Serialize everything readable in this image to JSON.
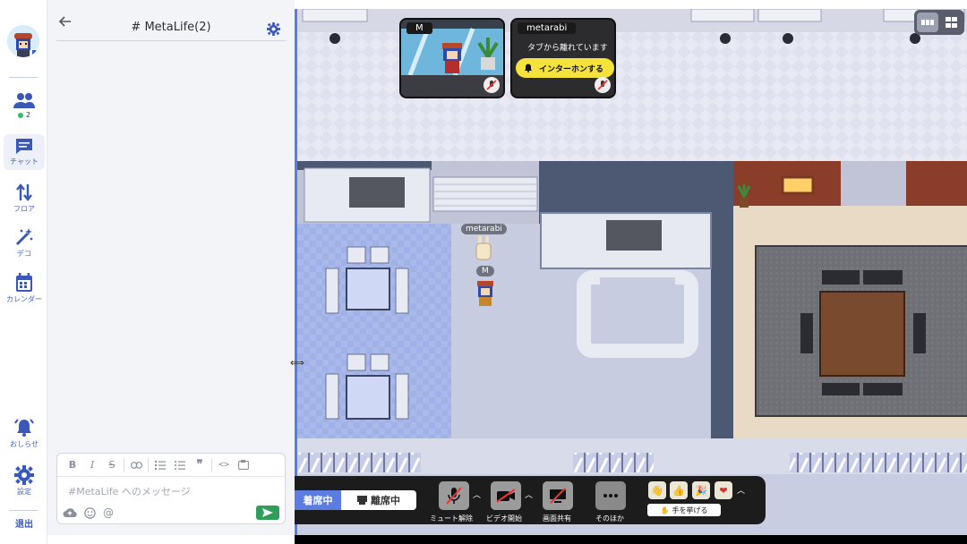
{
  "rail": {
    "members_label": "2",
    "chat_label": "チャット",
    "floor_label": "フロア",
    "deco_label": "デコ",
    "calendar_label": "カレンダー",
    "notice_label": "おしらせ",
    "settings_label": "設定",
    "exit_label": "退出"
  },
  "chat": {
    "title": "# MetaLife(2)",
    "placeholder": "#MetaLife へのメッセージ"
  },
  "video": {
    "self_name": "M",
    "other_name": "metarabi",
    "other_status": "タブから離れています",
    "intercom_label": "インターホンする"
  },
  "world": {
    "rabbit_name": "metarabi",
    "avatar_name": "M"
  },
  "toolbar": {
    "present_label": "着席中",
    "away_label": "離席中",
    "mute_label": "ミュート解除",
    "video_label": "ビデオ開始",
    "share_label": "画面共有",
    "more_label": "そのほか",
    "raise_hand_label": "手を挙げる"
  },
  "colors": {
    "accent": "#3a58b8",
    "active_status": "#5b7de0",
    "send": "#2e9e58",
    "online_dot": "#2fbf6a",
    "intercom": "#f5e23a"
  },
  "icons": [
    "avatar",
    "people-icon",
    "chat-icon",
    "floor-arrows-icon",
    "magic-wand-icon",
    "calendar-icon",
    "bell-icon",
    "gear-icon",
    "back-arrow-icon",
    "settings-gear-icon",
    "send-icon",
    "mic-off-icon",
    "camera-off-icon",
    "screen-share-off-icon",
    "more-icon",
    "raise-hand-icon"
  ]
}
